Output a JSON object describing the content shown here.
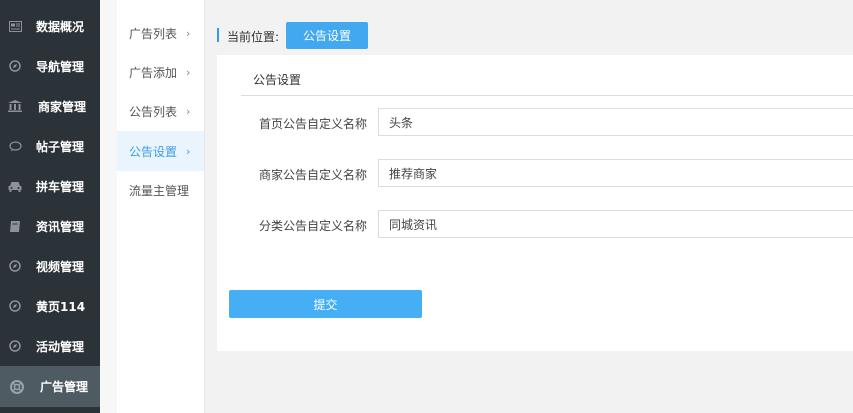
{
  "sidebar": {
    "items": [
      {
        "label": "数据概况",
        "icon": "dashboard-icon"
      },
      {
        "label": "导航管理",
        "icon": "compass-icon"
      },
      {
        "label": "商家管理",
        "icon": "bank-icon"
      },
      {
        "label": "帖子管理",
        "icon": "chat-bubble-icon"
      },
      {
        "label": "拼车管理",
        "icon": "car-icon"
      },
      {
        "label": "资讯管理",
        "icon": "book-icon"
      },
      {
        "label": "视频管理",
        "icon": "compass-icon"
      },
      {
        "label": "黄页114",
        "icon": "compass-icon"
      },
      {
        "label": "活动管理",
        "icon": "compass-icon"
      },
      {
        "label": "广告管理",
        "icon": "lifebuoy-icon",
        "active": true
      }
    ]
  },
  "submenu": {
    "items": [
      {
        "label": "广告列表",
        "chevron": "›"
      },
      {
        "label": "广告添加",
        "chevron": "›"
      },
      {
        "label": "公告列表",
        "chevron": "›"
      },
      {
        "label": "公告设置",
        "chevron": "›",
        "active": true
      },
      {
        "label": "流量主管理",
        "chevron": ""
      }
    ]
  },
  "breadcrumb": {
    "label": "当前位置:",
    "current": "公告设置"
  },
  "panel": {
    "title": "公告设置",
    "fields": [
      {
        "label": "首页公告自定义名称",
        "value": "头条"
      },
      {
        "label": "商家公告自定义名称",
        "value": "推荐商家"
      },
      {
        "label": "分类公告自定义名称",
        "value": "同城资讯"
      }
    ],
    "submit_label": "提交"
  },
  "colors": {
    "sidebar_bg": "#2b3338",
    "sidebar_active": "#4f5b63",
    "accent": "#42a8ef",
    "submenu_active_bg": "#eaf4fc"
  }
}
